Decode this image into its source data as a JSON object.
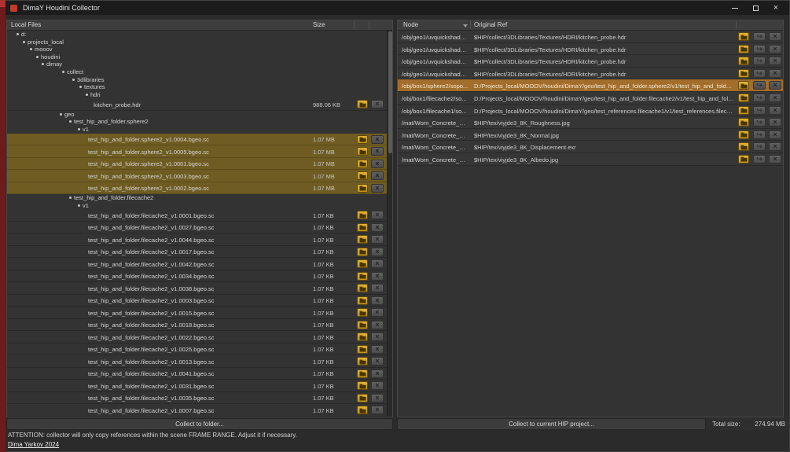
{
  "window": {
    "title": "DimaY Houdini Collector",
    "controls": [
      "minimize-icon",
      "maximize-icon",
      "close-icon"
    ]
  },
  "left_panel": {
    "header": {
      "name_col": "Local Files",
      "size_col": "Size"
    },
    "collect_button": "Collect to folder...",
    "tree": [
      {
        "kind": "dir",
        "label": "d:",
        "indent": 12
      },
      {
        "kind": "dir",
        "label": "projects_local",
        "indent": 20
      },
      {
        "kind": "dir",
        "label": "mooov",
        "indent": 29
      },
      {
        "kind": "dir",
        "label": "houdini",
        "indent": 37
      },
      {
        "kind": "dir",
        "label": "dimay",
        "indent": 44
      },
      {
        "kind": "dir",
        "label": "collect",
        "indent": 70
      },
      {
        "kind": "dir",
        "label": "3dlibraries",
        "indent": 83
      },
      {
        "kind": "dir",
        "label": "textures",
        "indent": 92
      },
      {
        "kind": "dir",
        "label": "hdri",
        "indent": 100
      },
      {
        "kind": "file",
        "label": "kitchen_probe.hdr",
        "indent": 110,
        "size": "988.06 KB",
        "selected": false
      },
      {
        "kind": "dir",
        "label": "geo",
        "indent": 67
      },
      {
        "kind": "dir",
        "label": "test_hip_and_folder.sphere2",
        "indent": 79
      },
      {
        "kind": "dir",
        "label": "v1",
        "indent": 90
      },
      {
        "kind": "file",
        "label": "test_hip_and_folder.sphere2_v1.0004.bgeo.sc",
        "indent": 103,
        "size": "1.07 MB",
        "selected": true
      },
      {
        "kind": "file",
        "label": "test_hip_and_folder.sphere2_v1.0005.bgeo.sc",
        "indent": 103,
        "size": "1.07 MB",
        "selected": true
      },
      {
        "kind": "file",
        "label": "test_hip_and_folder.sphere2_v1.0001.bgeo.sc",
        "indent": 103,
        "size": "1.07 MB",
        "selected": true
      },
      {
        "kind": "file",
        "label": "test_hip_and_folder.sphere2_v1.0003.bgeo.sc",
        "indent": 103,
        "size": "1.07 MB",
        "selected": true
      },
      {
        "kind": "file",
        "label": "test_hip_and_folder.sphere2_v1.0002.bgeo.sc",
        "indent": 103,
        "size": "1.07 MB",
        "selected": true
      },
      {
        "kind": "dir",
        "label": "test_hip_and_folder.filecache2",
        "indent": 79
      },
      {
        "kind": "dir",
        "label": "v1",
        "indent": 90
      },
      {
        "kind": "file",
        "label": "test_hip_and_folder.filecache2_v1.0001.bgeo.sc",
        "indent": 103,
        "size": "1.07 KB",
        "selected": false
      },
      {
        "kind": "file",
        "label": "test_hip_and_folder.filecache2_v1.0027.bgeo.sc",
        "indent": 103,
        "size": "1.07 KB",
        "selected": false
      },
      {
        "kind": "file",
        "label": "test_hip_and_folder.filecache2_v1.0044.bgeo.sc",
        "indent": 103,
        "size": "1.07 KB",
        "selected": false
      },
      {
        "kind": "file",
        "label": "test_hip_and_folder.filecache2_v1.0017.bgeo.sc",
        "indent": 103,
        "size": "1.07 KB",
        "selected": false
      },
      {
        "kind": "file",
        "label": "test_hip_and_folder.filecache2_v1.0042.bgeo.sc",
        "indent": 103,
        "size": "1.07 KB",
        "selected": false
      },
      {
        "kind": "file",
        "label": "test_hip_and_folder.filecache2_v1.0034.bgeo.sc",
        "indent": 103,
        "size": "1.07 KB",
        "selected": false
      },
      {
        "kind": "file",
        "label": "test_hip_and_folder.filecache2_v1.0038.bgeo.sc",
        "indent": 103,
        "size": "1.07 KB",
        "selected": false
      },
      {
        "kind": "file",
        "label": "test_hip_and_folder.filecache2_v1.0003.bgeo.sc",
        "indent": 103,
        "size": "1.07 KB",
        "selected": false
      },
      {
        "kind": "file",
        "label": "test_hip_and_folder.filecache2_v1.0015.bgeo.sc",
        "indent": 103,
        "size": "1.07 KB",
        "selected": false
      },
      {
        "kind": "file",
        "label": "test_hip_and_folder.filecache2_v1.0018.bgeo.sc",
        "indent": 103,
        "size": "1.07 KB",
        "selected": false
      },
      {
        "kind": "file",
        "label": "test_hip_and_folder.filecache2_v1.0022.bgeo.sc",
        "indent": 103,
        "size": "1.07 KB",
        "selected": false
      },
      {
        "kind": "file",
        "label": "test_hip_and_folder.filecache2_v1.0025.bgeo.sc",
        "indent": 103,
        "size": "1.07 KB",
        "selected": false
      },
      {
        "kind": "file",
        "label": "test_hip_and_folder.filecache2_v1.0013.bgeo.sc",
        "indent": 103,
        "size": "1.07 KB",
        "selected": false
      },
      {
        "kind": "file",
        "label": "test_hip_and_folder.filecache2_v1.0041.bgeo.sc",
        "indent": 103,
        "size": "1.07 KB",
        "selected": false
      },
      {
        "kind": "file",
        "label": "test_hip_and_folder.filecache2_v1.0031.bgeo.sc",
        "indent": 103,
        "size": "1.07 KB",
        "selected": false
      },
      {
        "kind": "file",
        "label": "test_hip_and_folder.filecache2_v1.0035.bgeo.sc",
        "indent": 103,
        "size": "1.07 KB",
        "selected": false
      },
      {
        "kind": "file",
        "label": "test_hip_and_folder.filecache2_v1.0007.bgeo.sc",
        "indent": 103,
        "size": "1.07 KB",
        "selected": false
      }
    ]
  },
  "right_panel": {
    "header": {
      "node_col": "Node",
      "ref_col": "Original Ref"
    },
    "collect_button": "Collect to current HIP project...",
    "total_size_label": "Total size:",
    "total_size_value": "274.94 MB",
    "rows": [
      {
        "node": "/obj/geo1/uvquickshade...",
        "ref": "$HIP/collect/3DLibraries/Textures/HDRI/kitchen_probe.hdr",
        "selected": false
      },
      {
        "node": "/obj/geo1/uvquickshade...",
        "ref": "$HIP/collect/3DLibraries/Textures/HDRI/kitchen_probe.hdr",
        "selected": false
      },
      {
        "node": "/obj/geo1/uvquickshade...",
        "ref": "$HIP/collect/3DLibraries/Textures/HDRI/kitchen_probe.hdr",
        "selected": false
      },
      {
        "node": "/obj/geo1/uvquickshade...",
        "ref": "$HIP/collect/3DLibraries/Textures/HDRI/kitchen_probe.hdr",
        "selected": false
      },
      {
        "node": "/obj/box1/sphere2/sopo...",
        "ref": "D:/Projects_local/MOOOV/houdini/DimaY/geo/test_hip_and_folder.sphere2/v1/test_hip_and_folder.sphere...",
        "selected": true
      },
      {
        "node": "/obj/box1/filecache2/so...",
        "ref": "D:/Projects_local/MOOOV/houdini/DimaY/geo/test_hip_and_folder.filecache2/v1/test_hip_and_folder.filec...",
        "selected": false
      },
      {
        "node": "/obj/box1/filecache1/so...",
        "ref": "D:/Projects_local/MOOOV/houdini/DimaY/geo/test_references.filecache1/v1/test_references.filecache1_v1...",
        "selected": false
      },
      {
        "node": "/mat/Worn_Concrete_Fl...",
        "ref": "$HIP/tex/viyjde3_8K_Roughness.jpg",
        "selected": false
      },
      {
        "node": "/mat/Worn_Concrete_Fl...",
        "ref": "$HIP/tex/viyjde3_8K_Normal.jpg",
        "selected": false
      },
      {
        "node": "/mat/Worn_Concrete_Fl...",
        "ref": "$HIP/tex/viyjde3_8K_Displacement.exr",
        "selected": false
      },
      {
        "node": "/mat/Worn_Concrete_Fl...",
        "ref": "$HIP/tex/viyjde3_8K_Albedo.jpg",
        "selected": false
      }
    ]
  },
  "footer": {
    "attention": "ATTENTION: collector will only copy references within the scene FRAME RANGE. Adjust it if necessary.",
    "credit": "Dima Yarkov 2024"
  },
  "icons": {
    "remove_glyph": "×",
    "relink_glyph": "↪"
  },
  "colors": {
    "edge_strip": "#6e1b1b",
    "titlebar_bg": "#1c1c1c",
    "window_bg": "#2b2b2b",
    "panel_bg": "#333333",
    "header_bg": "#3d3d3d",
    "selected_left": "#6f5c22",
    "selected_right": "#a36d2c",
    "accent_gold": "#d2a22c",
    "text": "#d4d4d4"
  }
}
